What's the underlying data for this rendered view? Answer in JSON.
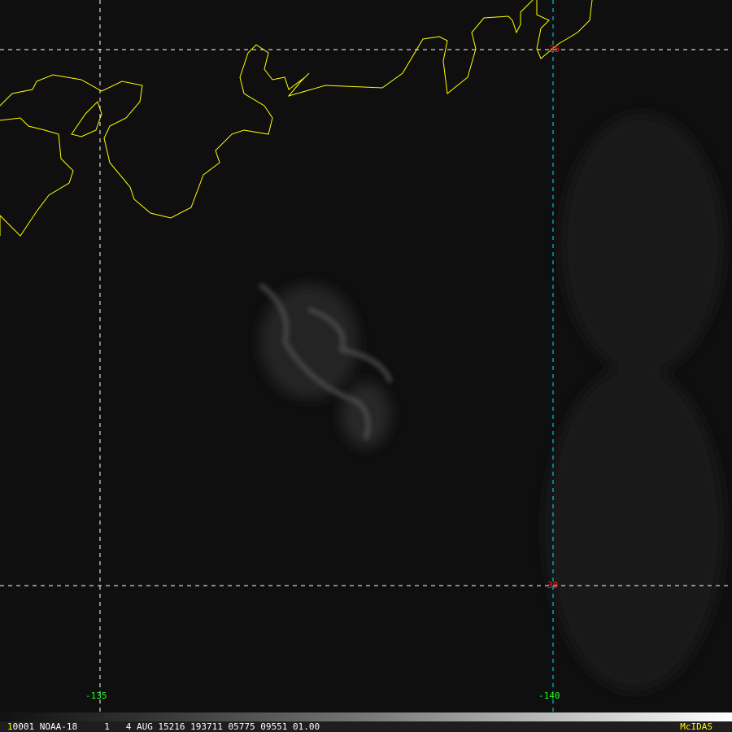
{
  "grid": {
    "lat_labels": [
      "35",
      "30"
    ],
    "lon_labels": [
      "-135",
      "-140"
    ]
  },
  "status_bar": {
    "frame_digit": "1",
    "info": "0001 NOAA-18     1   4 AUG 15216 193711 05775 09551 01.00",
    "brand": "McIDAS"
  },
  "colors": {
    "coastline": "#ffff00",
    "lat_line": "#ffffff",
    "lon_line_highlight": "#00e5ff",
    "lat_label": "#ff2020",
    "lon_label": "#20ff20",
    "brand": "#ffff00"
  }
}
